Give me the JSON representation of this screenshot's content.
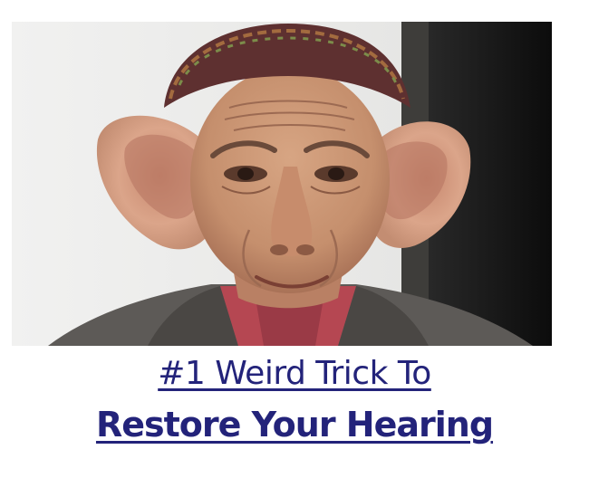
{
  "ad": {
    "headline_line1": "#1 Weird Trick To",
    "headline_line2": "Restore Your Hearing",
    "link_color": "#23237a"
  },
  "photo": {
    "subject": "elderly-man-with-large-ears"
  }
}
